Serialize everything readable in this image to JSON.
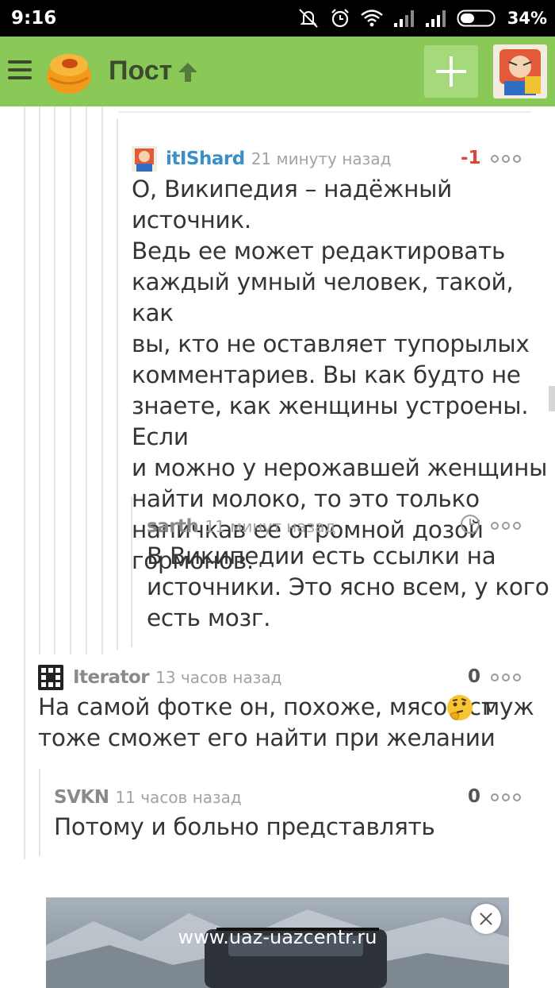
{
  "status_bar": {
    "time": "9:16",
    "battery": "34%",
    "icons": [
      "mute-icon",
      "alarm-icon",
      "wifi-icon",
      "signal-icon",
      "signal-icon",
      "battery-icon"
    ]
  },
  "app_bar": {
    "title": "Пост",
    "accent_color": "#8ac858",
    "icons": [
      "menu-icon",
      "logo-icon",
      "up-arrow-icon",
      "plus-icon",
      "avatar"
    ]
  },
  "comments": [
    {
      "author": "itIShard",
      "time": "21 минуту назад",
      "rating": "-1",
      "text": [
        "О, Википедия – надёжный источник.",
        "Ведь ее может редактировать",
        "каждый умный человек, такой, как",
        "вы, кто не оставляет тупорылых",
        "комментариев. Вы как будто не",
        "знаете, как женщины устроены. Если",
        "и можно у нерожавшей женщины",
        "найти молоко, то это только",
        "напичкав ее огромной дозой",
        "гормонов."
      ]
    },
    {
      "author": "sarth",
      "time": "11 минут назад",
      "text": [
        "В Википедии есть ссылки на",
        "источники. Это ясно всем, у кого",
        "есть мозг."
      ]
    },
    {
      "author": "Iterator",
      "time": "13 часов назад",
      "rating": "0",
      "text": [
        "На самой фотке он, похоже, мясо ест",
        "тоже сможет его найти при желании"
      ],
      "text_suffix": "муж"
    },
    {
      "author": "SVKN",
      "time": "11 часов назад",
      "rating": "0",
      "text": [
        "Потому и больно представлять"
      ]
    }
  ],
  "ad": {
    "url": "www.uaz-uazcentr.ru"
  }
}
